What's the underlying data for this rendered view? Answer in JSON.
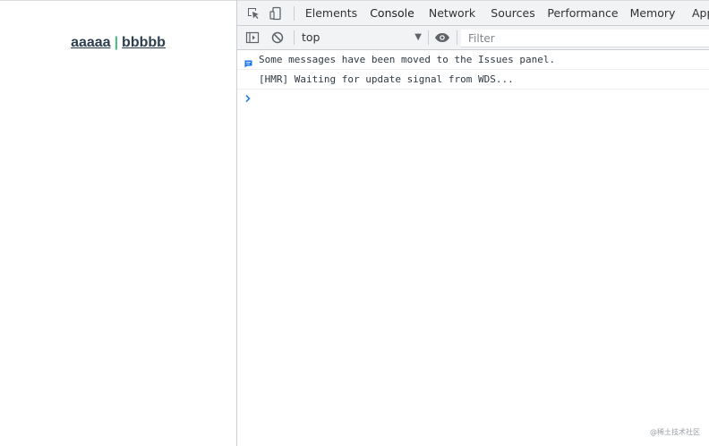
{
  "page": {
    "nav": {
      "link1": "aaaaa",
      "separator": "|",
      "link2": "bbbbb"
    }
  },
  "devtools": {
    "tabs": [
      {
        "label": "Elements",
        "active": false
      },
      {
        "label": "Console",
        "active": true
      },
      {
        "label": "Network",
        "active": false
      },
      {
        "label": "Sources",
        "active": false
      },
      {
        "label": "Performance",
        "active": false
      },
      {
        "label": "Memory",
        "active": false
      },
      {
        "label": "App",
        "active": false
      }
    ],
    "toolbar": {
      "context_value": "top",
      "filter_placeholder": "Filter"
    },
    "console": {
      "messages": [
        {
          "icon": "message-icon",
          "text": "Some messages have been moved to the Issues panel."
        },
        {
          "icon": "",
          "text": "[HMR] Waiting for update signal from WDS..."
        }
      ]
    },
    "colors": {
      "accent": "#1a73e8",
      "toolbar_bg": "#f1f3f4",
      "link": "#2c3e50",
      "separator": "#42b983"
    }
  },
  "watermark": "@稀土技术社区"
}
